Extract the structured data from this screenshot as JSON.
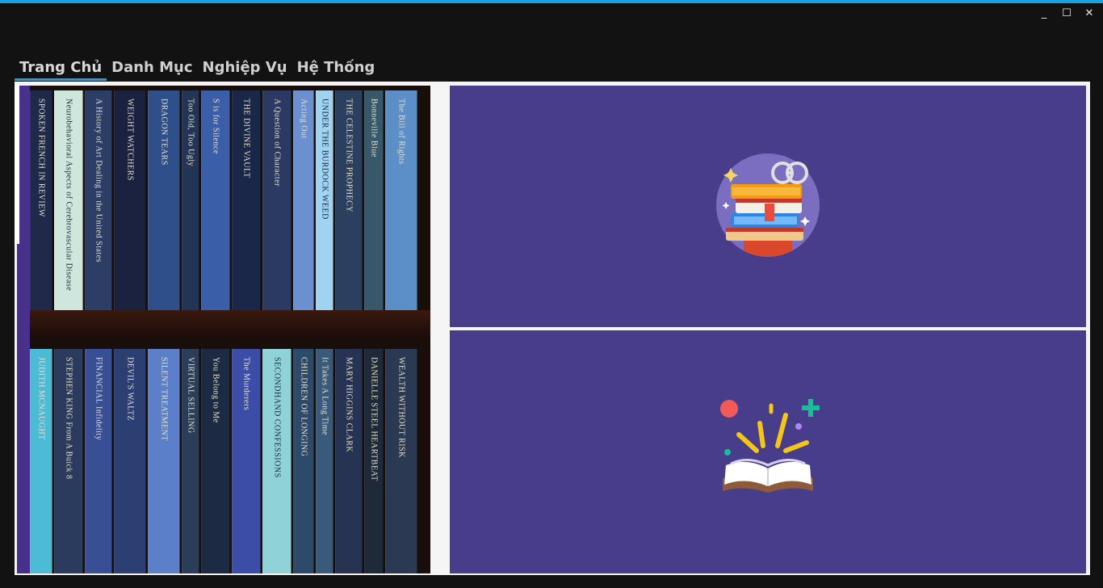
{
  "window": {
    "controls": {
      "minimize": "_",
      "maximize": "☐",
      "close": "✕"
    }
  },
  "menu": {
    "items": [
      {
        "label": "Trang Chủ",
        "active": true
      },
      {
        "label": "Danh Mục",
        "active": false
      },
      {
        "label": "Nghiệp Vụ",
        "active": false
      },
      {
        "label": "Hệ Thống",
        "active": false
      }
    ]
  },
  "colors": {
    "accent": "#1ba1e2",
    "panel": "#483d8b",
    "background": "#121212"
  },
  "shelf": {
    "top_row": [
      "SPOKEN FRENCH IN REVIEW",
      "Neurobehavioral Aspects of Cerebrovascular Disease",
      "A History of Art Dealing in the United States",
      "WEIGHT WATCHERS",
      "DRAGON TEARS",
      "Too Old, Too Ugly",
      "S is for Silence",
      "THE DIVINE VAULT",
      "A Question of Character",
      "Acting Out",
      "UNDER THE BURDOCK WEED",
      "THE CELESTINE PROPHECY",
      "Bonneville Blue",
      "The Bill of Rights"
    ],
    "bottom_row": [
      "JUDITH MCNAUGHT",
      "STEPHEN KING From A Buick 8",
      "FINANCIAL Infidelity",
      "DEVIL'S WALTZ",
      "SILENT TREATMENT",
      "VIRTUAL SELLING",
      "You Belong to Me",
      "The Murderers",
      "SECONDHAND CONFESSIONS",
      "CHILDREN OF LONGING",
      "It Takes A Long Time",
      "MARY HIGGINS CLARK",
      "DANIELLE STEEL HEARTBEAT",
      "WEALTH WITHOUT RISK"
    ]
  },
  "panels": {
    "top_icon": "books-with-glasses-icon",
    "bottom_icon": "open-book-icon"
  }
}
